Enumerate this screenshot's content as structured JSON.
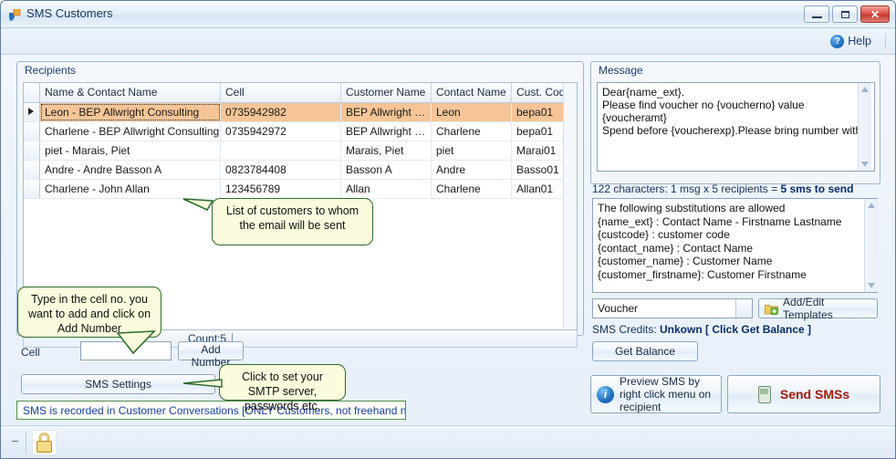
{
  "window": {
    "title": "SMS Customers",
    "app_icon": "app-squares-icon",
    "minimize_label": "Minimize",
    "maximize_label": "Maximize",
    "close_label": "✕"
  },
  "helpbar": {
    "help_label": "Help",
    "help_icon": "question-circle-icon"
  },
  "recipients": {
    "legend": "Recipients",
    "columns": [
      "",
      "Name  & Contact Name",
      "Cell",
      "Customer Name",
      "Contact Name",
      "Cust. Code"
    ],
    "rows": [
      {
        "selected": true,
        "marker": "▶",
        "name": "Leon - BEP Allwright Consulting",
        "cell": "0735942982",
        "customer_name": "BEP Allwright Co...",
        "contact_name": "Leon",
        "cust_code": "bepa01"
      },
      {
        "selected": false,
        "marker": "",
        "name": "Charlene - BEP Allwright Consulting",
        "cell": "0735942972",
        "customer_name": "BEP Allwright Co...",
        "contact_name": "Charlene",
        "cust_code": "bepa01"
      },
      {
        "selected": false,
        "marker": "",
        "name": "piet - Marais, Piet",
        "cell": "",
        "customer_name": "Marais, Piet",
        "contact_name": "piet",
        "cust_code": "Marai01"
      },
      {
        "selected": false,
        "marker": "",
        "name": "Andre - Andre Basson A",
        "cell": "0823784408",
        "customer_name": "Basson A",
        "contact_name": "Andre",
        "cust_code": "Basso01"
      },
      {
        "selected": false,
        "marker": "",
        "name": "Charlene - John Allan",
        "cell": "123456789",
        "customer_name": "Allan",
        "contact_name": "Charlene",
        "cust_code": "Allan01"
      }
    ],
    "count_label": "Count:5"
  },
  "cell_entry": {
    "label": "Cell",
    "value": "",
    "placeholder": "",
    "add_number_label": "Add Number"
  },
  "sms_settings": {
    "label": "SMS Settings"
  },
  "status_note": {
    "text": "SMS is recorded in Customer Conversations [ONLY Customers, not freehand numbers]"
  },
  "message": {
    "legend": "Message",
    "body": "Dear{name_ext}.\nPlease find voucher no {voucherno} value {voucheramt}\nSpend before {voucherexp}.Please bring number with.",
    "char_count_prefix": "122 characters: 1 msg x 5 recipients = ",
    "char_count_bold": "5 sms to send",
    "substitutions": "The following substitutions are allowed\n{name_ext} : Contact Name - Firstname Lastname\n{custcode} : customer code\n{contact_name} : Contact Name\n{customer_name} : Customer Name\n{customer_firstname}: Customer Firstname"
  },
  "templates": {
    "selected": "Voucher",
    "add_edit_label": "Add/Edit Templates",
    "add_edit_icon": "folder-plus-icon"
  },
  "credits": {
    "prefix": "SMS Credits:  ",
    "value": "Unkown [ Click Get Balance ]",
    "get_balance_label": "Get Balance"
  },
  "actions": {
    "preview_label": "Preview SMS by right click menu on recipient",
    "preview_icon": "info-circle-icon",
    "send_label": "Send SMSs",
    "send_icon": "mobile-phone-icon"
  },
  "callouts": {
    "list": "List of customers to whom the email will be sent",
    "cell": "Type in the cell no. you want to add and click on Add Number",
    "smtp": "Click to set your SMTP server, passwords etc."
  },
  "statusbar": {
    "lock_icon": "padlock-icon",
    "dash": "-"
  },
  "colors": {
    "selected_row": "#f5c597",
    "callout_fill": "#fbfbdd",
    "callout_border": "#2d6b2d",
    "send_text": "#a01c12",
    "note_text": "#1b3fa0"
  }
}
